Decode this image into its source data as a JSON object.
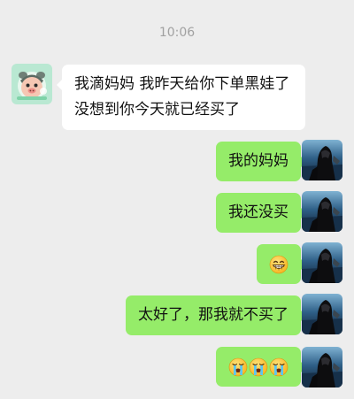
{
  "chat": {
    "timestamp": "10:06",
    "messages": [
      {
        "side": "left",
        "text": "我滴妈妈 我昨天给你下单黑娃了 没想到你今天就已经买了"
      },
      {
        "side": "right",
        "text": "我的妈妈"
      },
      {
        "side": "right",
        "text": "我还没买"
      },
      {
        "side": "right",
        "emojis": [
          "grin-emoji"
        ]
      },
      {
        "side": "right",
        "text": "太好了，那我就不买了"
      },
      {
        "side": "right",
        "emojis": [
          "loudly-crying-emoji",
          "loudly-crying-emoji",
          "loudly-crying-emoji"
        ]
      }
    ]
  },
  "colors": {
    "background": "#ededed",
    "sent_bubble": "#95ec69",
    "received_bubble": "#ffffff",
    "timestamp_text": "#a1a1a1"
  }
}
